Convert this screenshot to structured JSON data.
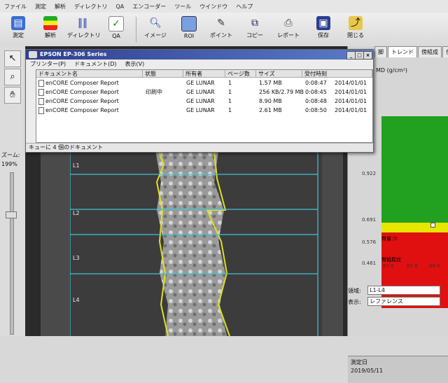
{
  "menubar": [
    "ファイル",
    "測定",
    "解析",
    "ディレクトリ",
    "QA",
    "エンコーダー",
    "ツール",
    "ウインドウ",
    "ヘルプ"
  ],
  "toolbar": {
    "measure": "測定",
    "analyze": "解析",
    "directory": "ディレクトリ",
    "qa": "QA",
    "image": "イメージ",
    "roi": "ROI",
    "point": "ポイント",
    "copy": "コピー",
    "report": "レポート",
    "save": "保存",
    "close": "閉じる"
  },
  "zoom": {
    "label": "ズーム:",
    "value": "199%"
  },
  "roi_labels": [
    "L1",
    "L2",
    "L3",
    "L4"
  ],
  "dialog": {
    "title": "EPSON EP-306 Series",
    "menu": [
      "プリンター(P)",
      "ドキュメント(D)",
      "表示(V)"
    ],
    "columns": [
      "ドキュメント名",
      "状態",
      "所有者",
      "ページ数",
      "サイズ",
      "受付時刻"
    ],
    "rows": [
      {
        "name": "enCORE Composer Report",
        "status": "",
        "owner": "GE LUNAR",
        "pages": "1",
        "size": "1.57 MB",
        "time": "0:08:47",
        "date": "2014/01/01"
      },
      {
        "name": "enCORE Composer Report",
        "status": "印刷中",
        "owner": "GE LUNAR",
        "pages": "1",
        "size": "256 KB/2.79 MB",
        "time": "0:08:45",
        "date": "2014/01/01"
      },
      {
        "name": "enCORE Composer Report",
        "status": "",
        "owner": "GE LUNAR",
        "pages": "1",
        "size": "8.90 MB",
        "time": "0:08:48",
        "date": "2014/01/01"
      },
      {
        "name": "enCORE Composer Report",
        "status": "",
        "owner": "GE LUNAR",
        "pages": "1",
        "size": "2.61 MB",
        "time": "0:08:50",
        "date": "2014/01/01"
      }
    ],
    "status": "キューに 4 個のドキュメント"
  },
  "right_panel": {
    "tabs": [
      "脚",
      "トレンド",
      "傍組成",
      "傍サマ"
    ],
    "unit": "MD (g/cm²)",
    "y_ticks": [
      "0.922",
      "0.691",
      "0.576",
      "0.461"
    ],
    "x_ticks": [
      "67.6",
      "67.8",
      "68.0"
    ],
    "band_label": "骨量:少",
    "bottom_label": "骨粗鬆症",
    "region_label": "領域:",
    "region_value": "L1-L4",
    "display_label": "表示:",
    "display_value": "レファレンス",
    "date_label": "測定日",
    "date_value": "2019/05/11"
  },
  "colors": {
    "green": "#22a020",
    "yellow": "#e6e600",
    "red": "#e01010",
    "title": "#2e3f8f",
    "roi_line": "#3fc3d9",
    "bone_edge": "#e0e020"
  }
}
